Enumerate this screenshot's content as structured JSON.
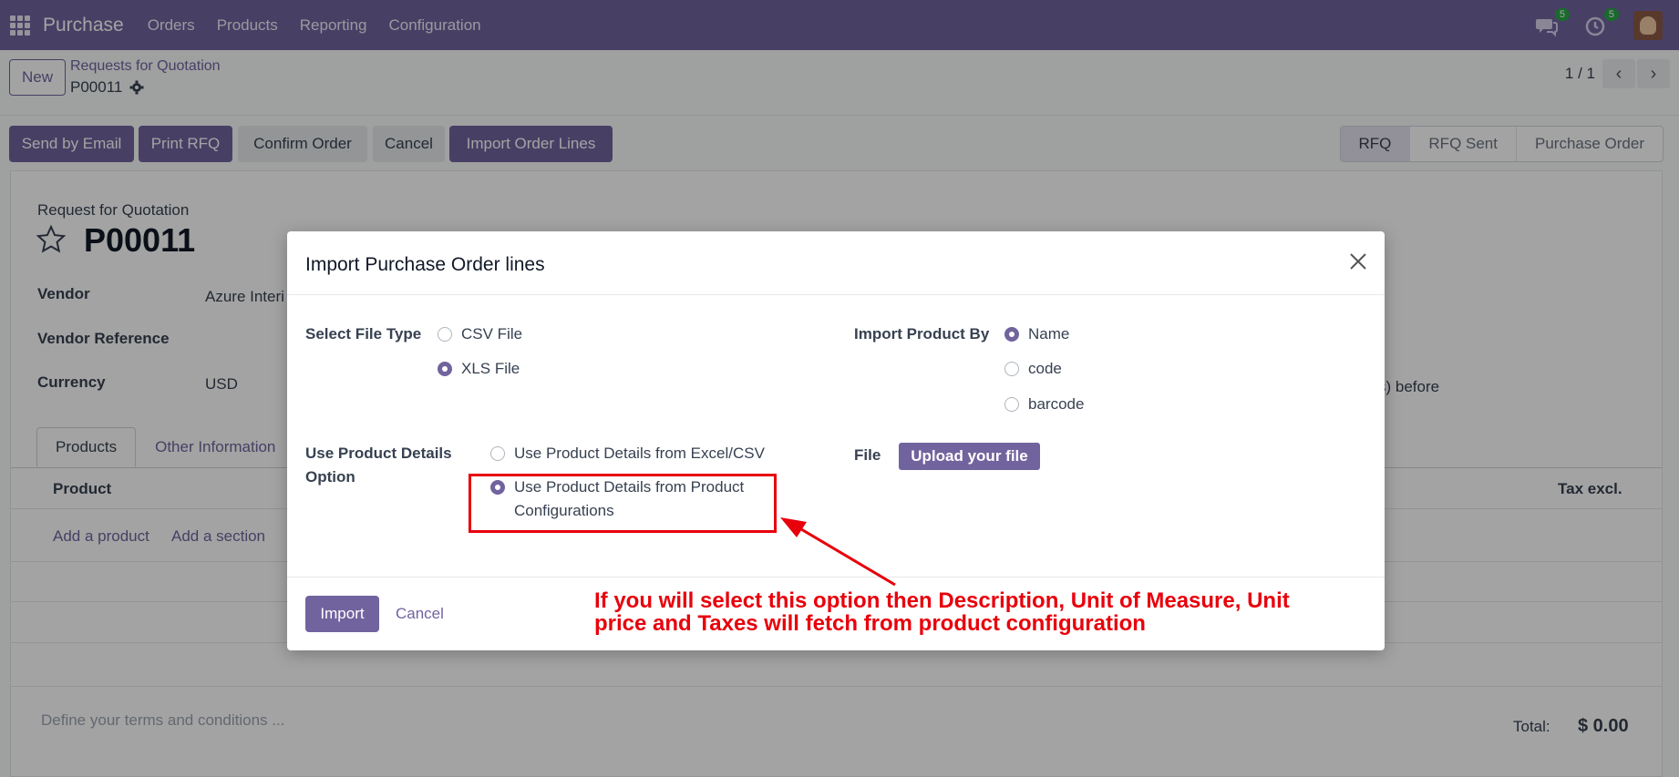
{
  "topbar": {
    "app_name": "Purchase",
    "menu": [
      "Orders",
      "Products",
      "Reporting",
      "Configuration"
    ],
    "messages_count": "5",
    "activities_count": "5"
  },
  "control": {
    "new_label": "New",
    "breadcrumb_parent": "Requests for Quotation",
    "breadcrumb_current": "P00011",
    "pager": "1 / 1"
  },
  "actions": {
    "send_email": "Send by Email",
    "print_rfq": "Print RFQ",
    "confirm_order": "Confirm Order",
    "cancel": "Cancel",
    "import_lines": "Import Order Lines",
    "stages": [
      "RFQ",
      "RFQ Sent",
      "Purchase Order"
    ]
  },
  "form": {
    "doc_type": "Request for Quotation",
    "doc_name": "P00011",
    "vendor_label": "Vendor",
    "vendor_value": "Azure Interi",
    "vendor_ref_label": "Vendor Reference",
    "currency_label": "Currency",
    "currency_value": "USD",
    "right_partial": "s) before",
    "tabs": [
      "Products",
      "Other Information"
    ],
    "col_product": "Product",
    "col_tax": "Tax excl.",
    "add_product": "Add a product",
    "add_section": "Add a section",
    "terms_placeholder": "Define your terms and conditions ...",
    "total_label": "Total:",
    "total_value": "$ 0.00"
  },
  "modal": {
    "title": "Import Purchase Order lines",
    "file_type_label": "Select File Type",
    "file_type_options": [
      "CSV File",
      "XLS File"
    ],
    "file_type_selected": "XLS File",
    "import_by_label": "Import Product By",
    "import_by_options": [
      "Name",
      "code",
      "barcode"
    ],
    "import_by_selected": "Name",
    "details_label_1": "Use Product Details",
    "details_label_2": "Option",
    "details_options": [
      "Use Product Details from Excel/CSV",
      "Use Product Details from Product",
      "Configurations"
    ],
    "file_label": "File",
    "upload_label": "Upload your file",
    "import_label": "Import",
    "cancel_label": "Cancel"
  },
  "annotation": {
    "line1": "If you will select this option then Description, Unit of Measure, Unit",
    "line2": "price and Taxes will fetch from product configuration"
  },
  "colors": {
    "brand": "#71639e",
    "annotation_red": "#e8000b",
    "badge_green": "#28a745"
  }
}
